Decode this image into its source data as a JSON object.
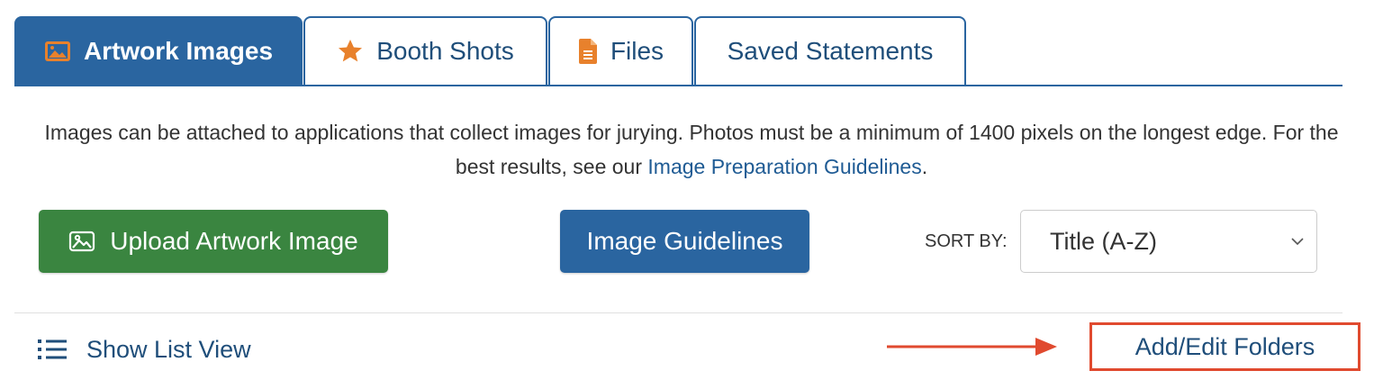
{
  "tabs": [
    {
      "label": "Artwork Images",
      "icon": "image-icon",
      "active": true
    },
    {
      "label": "Booth Shots",
      "icon": "star-icon",
      "active": false
    },
    {
      "label": "Files",
      "icon": "file-icon",
      "active": false
    },
    {
      "label": "Saved Statements",
      "icon": "",
      "active": false
    }
  ],
  "description": {
    "text": "Images can be attached to applications that collect images for jurying. Photos must be a minimum of 1400 pixels on the longest edge. For the best results, see our ",
    "link": "Image Preparation Guidelines",
    "suffix": "."
  },
  "buttons": {
    "upload": "Upload Artwork Image",
    "guidelines": "Image Guidelines"
  },
  "sort": {
    "label": "SORT BY:",
    "selected": "Title (A-Z)"
  },
  "list_view": "Show List View",
  "folders": "Add/Edit Folders",
  "colors": {
    "primary": "#2a65a0",
    "success": "#3a8540",
    "accent_orange": "#e8812c",
    "highlight_red": "#e04a2f"
  }
}
